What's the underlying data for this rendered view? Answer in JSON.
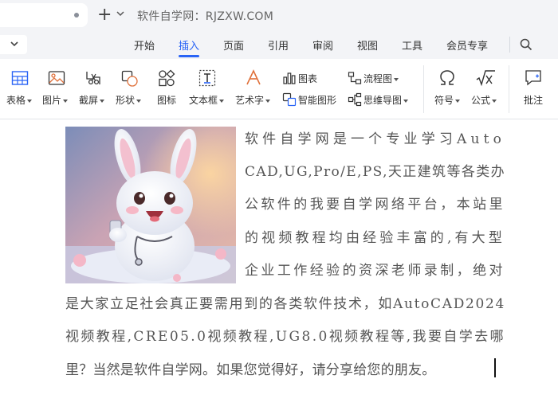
{
  "title_bar": {
    "site_title": "软件自学网：RJZXW.COM",
    "new_tab_symbol": "+"
  },
  "menu": {
    "items": [
      "开始",
      "插入",
      "页面",
      "引用",
      "审阅",
      "视图",
      "工具",
      "会员专享"
    ],
    "active": "插入",
    "accent": "#2a64f6"
  },
  "toolbar": {
    "table": "表格",
    "image": "图片",
    "screenshot": "截屏",
    "shape": "形状",
    "icon": "图标",
    "textbox": "文本框",
    "wordart": "艺术字",
    "chart": "图表",
    "smartart": "智能图形",
    "flowchart": "流程图",
    "mindmap": "思维导图",
    "symbol": "符号",
    "formula": "公式",
    "comment": "批注"
  },
  "document": {
    "image_alt": "白色卡通兔子",
    "lines": [
      "软件自学网是一个专业学习Auto",
      "CAD,UG,Pro/E,PS,天正建筑等各类办",
      "公软件的我要自学网络平台，本站里",
      "的视频教程均由经验丰富的,有大型",
      "企业工作经验的资深老师录制，绝对",
      "是大家立足社会真正要需用到的各类软件技术，如AutoCAD2024",
      "视频教程,CRE05.0视频教程,UG8.0视频教程等,我要自学去哪",
      "里？当然是软件自学网。如果您觉得好，请分享给您的朋友。"
    ]
  }
}
